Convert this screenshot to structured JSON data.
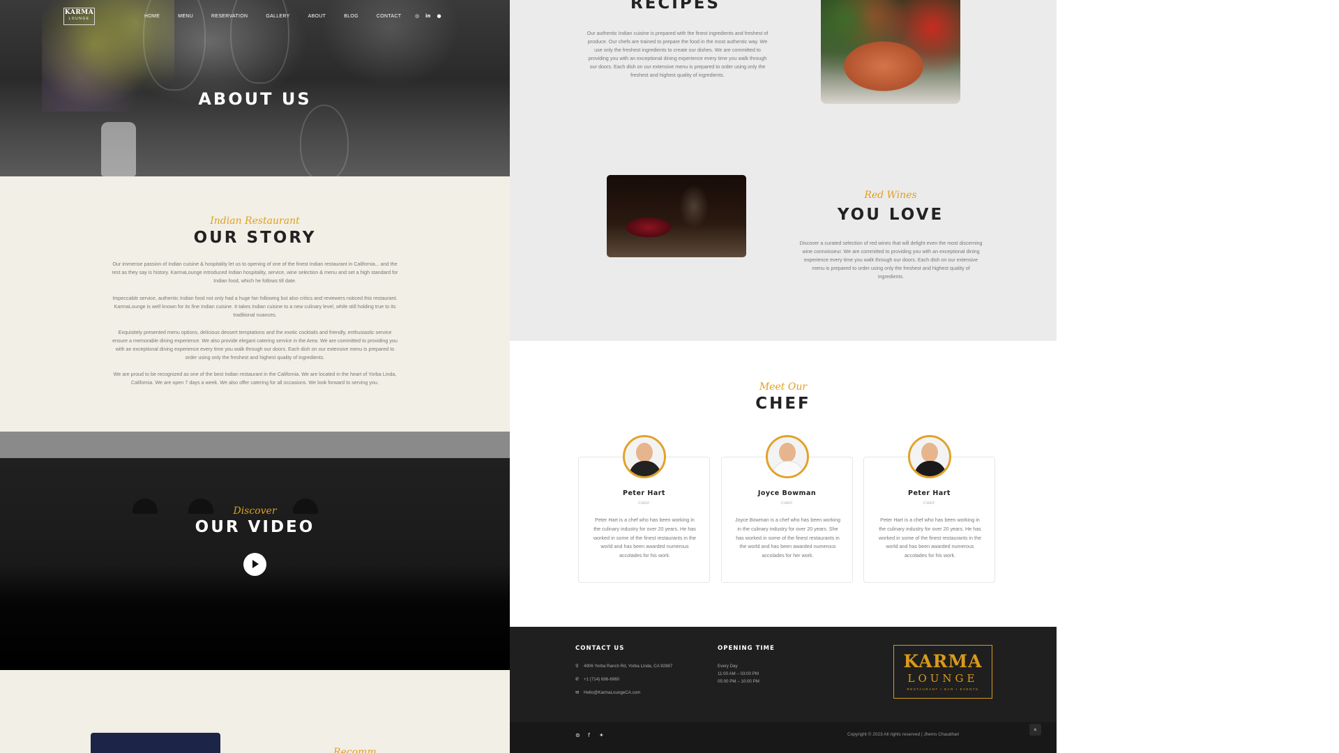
{
  "brand": {
    "logo_line1": "KARMA",
    "logo_line2": "LOUNGE"
  },
  "nav": {
    "items": [
      "HOME",
      "MENU",
      "RESERVATION",
      "GALLERY",
      "ABOUT",
      "BLOG",
      "CONTACT"
    ]
  },
  "socials_top": [
    "instagram-icon",
    "linkedin-icon",
    "github-icon"
  ],
  "hero": {
    "title": "ABOUT US"
  },
  "story": {
    "kicker": "Indian Restaurant",
    "title": "OUR STORY",
    "paragraphs": [
      "Our immense passion of Indian cuisine & hospitality let us to opening of one of the finest Indian restaurant in California... and the rest as they say is history. KarmaLounge introduced Indian hospitality, service, wine selection & menu and set a high standard for Indian food, which he follows till date.",
      "Impeccable service, authentic Indian food not only had a huge fan following but also critics and reviewers noticed this restaurant. KarmaLounge is well known for its fine Indian cuisine. It takes Indian cuisine to a new culinary level, while still holding true to its traditional nuances.",
      "Exquisitely presented menu options, delicious dessert temptations and the exotic cocktails and friendly, enthusiastic service ensure a memorable dining experience. We also provide elegant catering service in the Area. We are committed to providing you with an exceptional dining experience every time you walk through our doors. Each dish on our extensive menu is prepared to order using only the freshest and highest quality of ingredients.",
      "We are proud to be recognized as one of the best Indian restaurant in the California. We are located in the heart of Yorba Linda, California. We are open 7 days a week. We also offer catering for all occasions. We look forward to serving you."
    ]
  },
  "video": {
    "kicker": "Discover",
    "title": "OUR VIDEO"
  },
  "tail": {
    "kicker": "Recomm..."
  },
  "recipes": {
    "title": "RECIPES",
    "text": "Our authentic Indian cuisine is prepared with the finest ingredients and freshest of produce. Our chefs are trained to prepare the food in the most authentic way. We use only the freshest ingredients to create our dishes. We are committed to providing you with an exceptional dining experience every time you walk through our doors. Each dish on our extensive menu is prepared to order using only the freshest and highest quality of ingredients."
  },
  "wines": {
    "kicker": "Red Wines",
    "title": "YOU LOVE",
    "text": "Discover a curated selection of red wines that will delight even the most discerning wine connoisseur. We are committed to providing you with an exceptional dining experience every time you walk through our doors. Each dish on our extensive menu is prepared to order using only the freshest and highest quality of ingredients."
  },
  "chef": {
    "kicker": "Meet Our",
    "title": "CHEF",
    "cards": [
      {
        "name": "Peter Hart",
        "role": "CHEF",
        "bio": "Peter Hart is a chef who has been working in the culinary industry for over 20 years. He has worked in some of the finest restaurants in the world and has been awarded numerous accolades for his work."
      },
      {
        "name": "Joyce Bowman",
        "role": "CHEF",
        "bio": "Joyce Bowman is a chef who has been working in the culinary industry for over 20 years. She has worked in some of the finest restaurants in the world and has been awarded numerous accolades for her work."
      },
      {
        "name": "Peter Hart",
        "role": "CHEF",
        "bio": "Peter Hart is a chef who has been working in the culinary industry for over 20 years. He has worked in some of the finest restaurants in the world and has been awarded numerous accolades for his work."
      }
    ]
  },
  "footer": {
    "contact_heading": "CONTACT US",
    "address": "4906 Yorba Ranch Rd, Yorba Linda, CA 92887",
    "phone": "+1 (714) 696-6960",
    "email": "Hello@KarmaLoungeCA.com",
    "opening_heading": "OPENING TIME",
    "opening_days": "Every Day",
    "opening_hours_1": "11:00 AM – 03:00 PM",
    "opening_hours_2": "05:00 PM – 10:00 PM",
    "logo_big_1": "KARMA",
    "logo_big_2": "LOUNGE",
    "logo_big_3": "RESTAURANT • BAR • EVENTS",
    "copyright": "Copyright © 2023 All rights reserved | Jhems Chaudhari",
    "to_top": "«"
  },
  "colors": {
    "accent": "#e0a020",
    "footer_bg": "#1f1f1f",
    "story_bg": "#f2efe6",
    "recipes_bg": "#ebebeb"
  }
}
